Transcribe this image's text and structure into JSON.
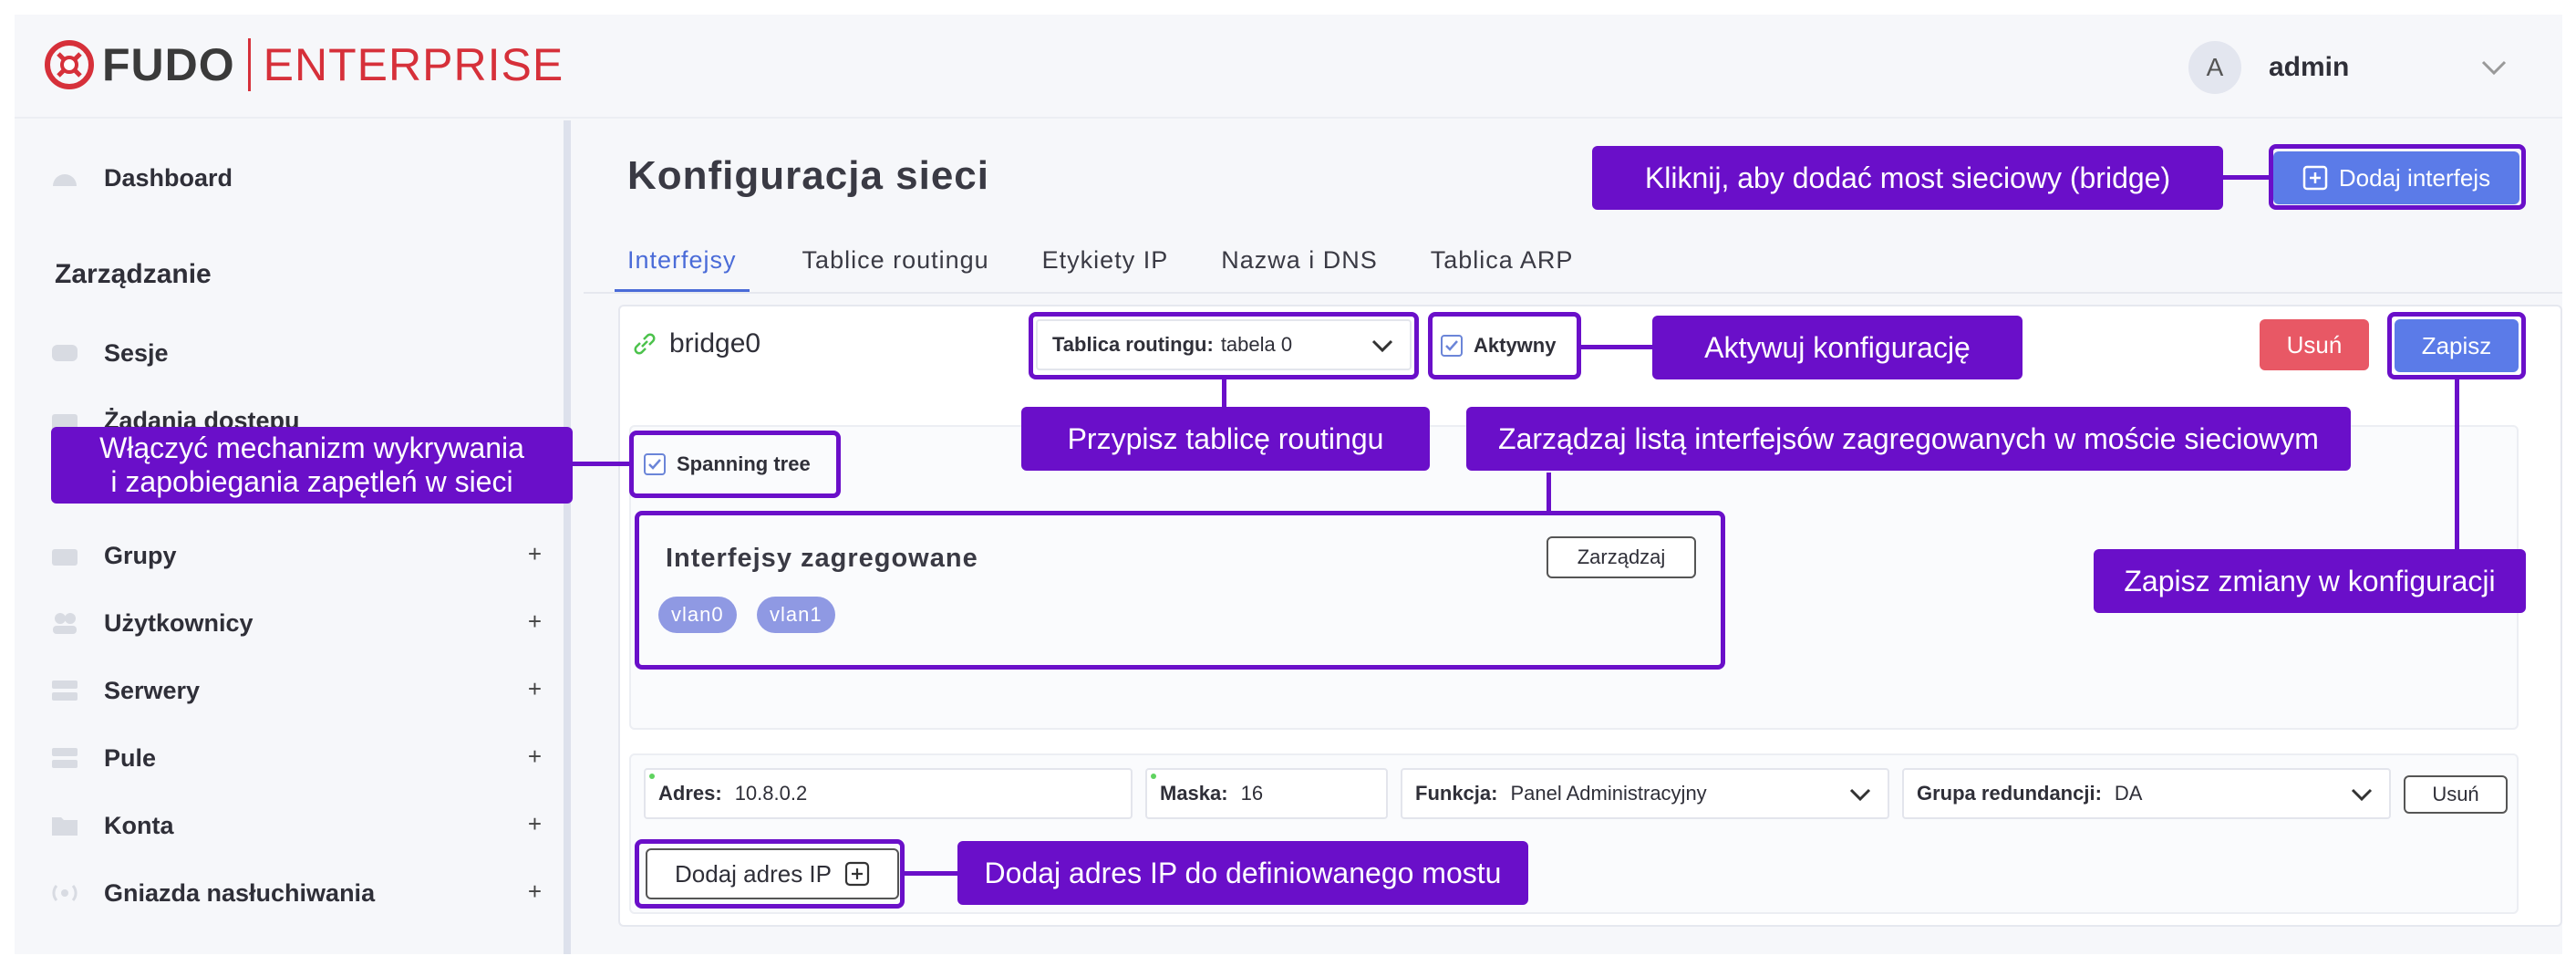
{
  "header": {
    "logo_brand": "FUDO",
    "logo_product": "ENTERPRISE",
    "user_initial": "A",
    "user_name": "admin"
  },
  "sidebar": {
    "dashboard": "Dashboard",
    "section": "Zarządzanie",
    "items": [
      {
        "label": "Sesje"
      },
      {
        "label": "Żądania dostępu"
      },
      {
        "label": "Grupy",
        "expand": "+"
      },
      {
        "label": "Użytkownicy",
        "expand": "+"
      },
      {
        "label": "Serwery",
        "expand": "+"
      },
      {
        "label": "Pule",
        "expand": "+"
      },
      {
        "label": "Konta",
        "expand": "+"
      },
      {
        "label": "Gniazda nasłuchiwania",
        "expand": "+"
      }
    ]
  },
  "main": {
    "title": "Konfiguracja sieci",
    "add_interface": "Dodaj interfejs",
    "tabs": [
      {
        "label": "Interfejsy",
        "active": true
      },
      {
        "label": "Tablice routingu"
      },
      {
        "label": "Etykiety IP"
      },
      {
        "label": "Nazwa i DNS"
      },
      {
        "label": "Tablica ARP"
      }
    ],
    "interface": {
      "name": "bridge0",
      "routing_label": "Tablica routingu:",
      "routing_value": "tabela 0",
      "active_label": "Aktywny",
      "delete": "Usuń",
      "save": "Zapisz",
      "spanning_tree": "Spanning tree",
      "aggregated_title": "Interfejsy zagregowane",
      "manage": "Zarządzaj",
      "tags": [
        "vlan0",
        "vlan1"
      ],
      "address": {
        "addr_label": "Adres:",
        "addr_value": "10.8.0.2",
        "mask_label": "Maska:",
        "mask_value": "16",
        "func_label": "Funkcja:",
        "func_value": "Panel Administracyjny",
        "red_label": "Grupa redundancji:",
        "red_value": "DA",
        "delete": "Usuń"
      },
      "add_ip": "Dodaj adres IP"
    }
  },
  "annotations": {
    "add_bridge": "Kliknij, aby dodać most sieciowy (bridge)",
    "activate": "Aktywuj konfigurację",
    "assign_routing": "Przypisz tablicę routingu",
    "manage_list": "Zarządzaj listą interfejsów zagregowanych w moście sieciowym",
    "stp_line1": "Włączyć mechanizm wykrywania",
    "stp_line2": "i zapobiegania zapętleń w sieci",
    "save_changes": "Zapisz zmiany w konfiguracji",
    "add_ip": "Dodaj adres IP do definiowanego mostu"
  },
  "colors": {
    "accent": "#5b7be8",
    "danger": "#e85865",
    "annotation": "#6a0fc9",
    "brand": "#d6303a",
    "tag": "#8f99e3"
  }
}
